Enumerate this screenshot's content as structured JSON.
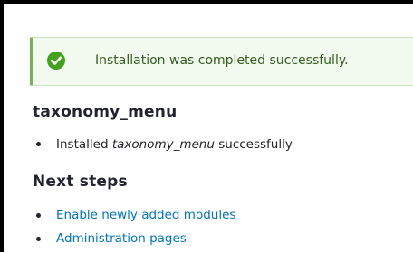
{
  "status": {
    "message": "Installation was completed successfully.",
    "icon": "check-circle-icon",
    "accent_color": "#77b259",
    "background_color": "#f3faef"
  },
  "module": {
    "title": "taxonomy_menu",
    "installed_prefix": "Installed ",
    "installed_name": "taxonomy_menu",
    "installed_suffix": " successfully"
  },
  "next_steps": {
    "title": "Next steps",
    "links": [
      {
        "label": "Enable newly added modules"
      },
      {
        "label": "Administration pages"
      }
    ]
  },
  "colors": {
    "link": "#0074bd",
    "text": "#222330"
  }
}
